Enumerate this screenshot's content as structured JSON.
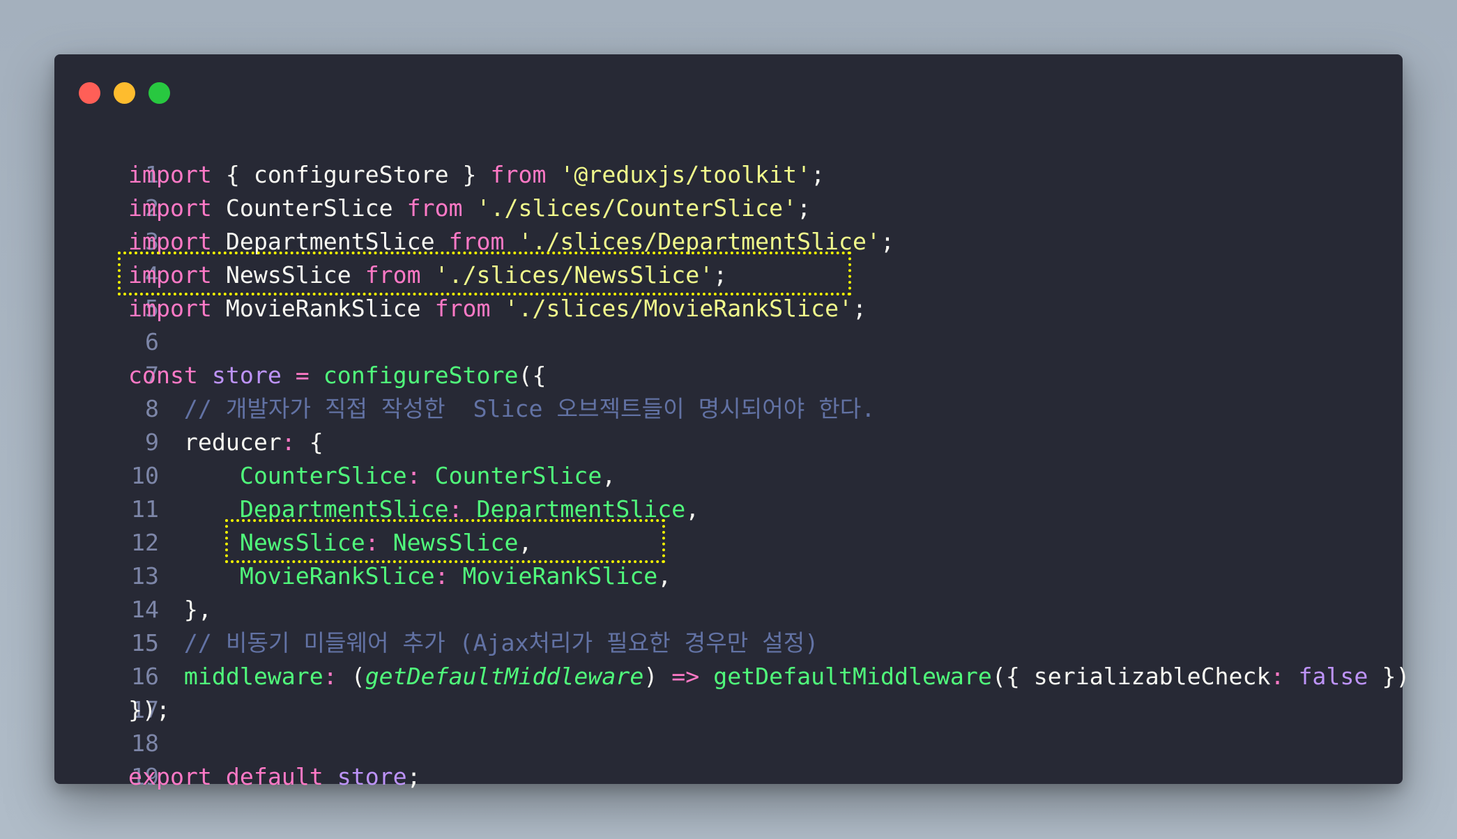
{
  "window": {
    "controls": [
      "close",
      "minimize",
      "maximize"
    ],
    "colors": {
      "close": "#ff5f57",
      "minimize": "#febc2e",
      "maximize": "#28c840",
      "background": "#272935",
      "keyword": "#ff79c6",
      "string": "#f1fa8c",
      "function": "#50fa7b",
      "variable": "#bd93f9",
      "comment": "#6272a4",
      "plain": "#f8f8f2",
      "highlight": "#f5f500"
    }
  },
  "code": {
    "language": "javascript",
    "lines": [
      {
        "n": "1",
        "t": [
          {
            "c": "kw",
            "v": "import"
          },
          {
            "c": "pl",
            "v": " { configureStore } "
          },
          {
            "c": "kw",
            "v": "from"
          },
          {
            "c": "pl",
            "v": " "
          },
          {
            "c": "str",
            "v": "'@reduxjs/toolkit'"
          },
          {
            "c": "pl",
            "v": ";"
          }
        ]
      },
      {
        "n": "2",
        "t": [
          {
            "c": "kw",
            "v": "import"
          },
          {
            "c": "pl",
            "v": " CounterSlice "
          },
          {
            "c": "kw",
            "v": "from"
          },
          {
            "c": "pl",
            "v": " "
          },
          {
            "c": "str",
            "v": "'./slices/CounterSlice'"
          },
          {
            "c": "pl",
            "v": ";"
          }
        ]
      },
      {
        "n": "3",
        "t": [
          {
            "c": "kw",
            "v": "import"
          },
          {
            "c": "pl",
            "v": " DepartmentSlice "
          },
          {
            "c": "kw",
            "v": "from"
          },
          {
            "c": "pl",
            "v": " "
          },
          {
            "c": "str",
            "v": "'./slices/DepartmentSlice'"
          },
          {
            "c": "pl",
            "v": ";"
          }
        ]
      },
      {
        "n": "4",
        "t": [
          {
            "c": "kw",
            "v": "import"
          },
          {
            "c": "pl",
            "v": " NewsSlice "
          },
          {
            "c": "kw",
            "v": "from"
          },
          {
            "c": "pl",
            "v": " "
          },
          {
            "c": "str",
            "v": "'./slices/NewsSlice'"
          },
          {
            "c": "pl",
            "v": ";"
          }
        ]
      },
      {
        "n": "5",
        "t": [
          {
            "c": "kw",
            "v": "import"
          },
          {
            "c": "pl",
            "v": " MovieRankSlice "
          },
          {
            "c": "kw",
            "v": "from"
          },
          {
            "c": "pl",
            "v": " "
          },
          {
            "c": "str",
            "v": "'./slices/MovieRankSlice'"
          },
          {
            "c": "pl",
            "v": ";"
          }
        ]
      },
      {
        "n": "6",
        "t": []
      },
      {
        "n": "7",
        "t": [
          {
            "c": "kw",
            "v": "const"
          },
          {
            "c": "pl",
            "v": " "
          },
          {
            "c": "var",
            "v": "store"
          },
          {
            "c": "pl",
            "v": " "
          },
          {
            "c": "kw",
            "v": "="
          },
          {
            "c": "pl",
            "v": " "
          },
          {
            "c": "fn",
            "v": "configureStore"
          },
          {
            "c": "pl",
            "v": "({"
          }
        ]
      },
      {
        "n": "8",
        "t": [
          {
            "c": "cm",
            "v": "    // 개발자가 직접 작성한  Slice 오브젝트들이 명시되어야 한다."
          }
        ]
      },
      {
        "n": "9",
        "t": [
          {
            "c": "pl",
            "v": "    reducer"
          },
          {
            "c": "kw",
            "v": ":"
          },
          {
            "c": "pl",
            "v": " {"
          }
        ]
      },
      {
        "n": "10",
        "t": [
          {
            "c": "fn",
            "v": "        CounterSlice"
          },
          {
            "c": "kw",
            "v": ":"
          },
          {
            "c": "pl",
            "v": " "
          },
          {
            "c": "fn",
            "v": "CounterSlice"
          },
          {
            "c": "pl",
            "v": ","
          }
        ]
      },
      {
        "n": "11",
        "t": [
          {
            "c": "fn",
            "v": "        DepartmentSlice"
          },
          {
            "c": "kw",
            "v": ":"
          },
          {
            "c": "pl",
            "v": " "
          },
          {
            "c": "fn",
            "v": "DepartmentSlice"
          },
          {
            "c": "pl",
            "v": ","
          }
        ]
      },
      {
        "n": "12",
        "t": [
          {
            "c": "fn",
            "v": "        NewsSlice"
          },
          {
            "c": "kw",
            "v": ":"
          },
          {
            "c": "pl",
            "v": " "
          },
          {
            "c": "fn",
            "v": "NewsSlice"
          },
          {
            "c": "pl",
            "v": ","
          }
        ]
      },
      {
        "n": "13",
        "t": [
          {
            "c": "fn",
            "v": "        MovieRankSlice"
          },
          {
            "c": "kw",
            "v": ":"
          },
          {
            "c": "pl",
            "v": " "
          },
          {
            "c": "fn",
            "v": "MovieRankSlice"
          },
          {
            "c": "pl",
            "v": ","
          }
        ]
      },
      {
        "n": "14",
        "t": [
          {
            "c": "pl",
            "v": "    },"
          }
        ]
      },
      {
        "n": "15",
        "t": [
          {
            "c": "cm",
            "v": "    // 비동기 미들웨어 추가 (Ajax처리가 필요한 경우만 설정)"
          }
        ]
      },
      {
        "n": "16",
        "t": [
          {
            "c": "fn",
            "v": "    middleware"
          },
          {
            "c": "kw",
            "v": ":"
          },
          {
            "c": "pl",
            "v": " ("
          },
          {
            "c": "param",
            "v": "getDefaultMiddleware"
          },
          {
            "c": "pl",
            "v": ") "
          },
          {
            "c": "kw",
            "v": "=>"
          },
          {
            "c": "pl",
            "v": " "
          },
          {
            "c": "fn",
            "v": "getDefaultMiddleware"
          },
          {
            "c": "pl",
            "v": "({ serializableCheck"
          },
          {
            "c": "kw",
            "v": ":"
          },
          {
            "c": "pl",
            "v": " "
          },
          {
            "c": "var",
            "v": "false"
          },
          {
            "c": "pl",
            "v": " })"
          }
        ]
      },
      {
        "n": "17",
        "t": [
          {
            "c": "pl",
            "v": "});"
          }
        ]
      },
      {
        "n": "18",
        "t": []
      },
      {
        "n": "19",
        "t": [
          {
            "c": "kw",
            "v": "export"
          },
          {
            "c": "pl",
            "v": " "
          },
          {
            "c": "kw",
            "v": "default"
          },
          {
            "c": "pl",
            "v": " "
          },
          {
            "c": "var",
            "v": "store"
          },
          {
            "c": "pl",
            "v": ";"
          }
        ]
      }
    ],
    "highlighted_lines": [
      "5",
      "13"
    ]
  }
}
